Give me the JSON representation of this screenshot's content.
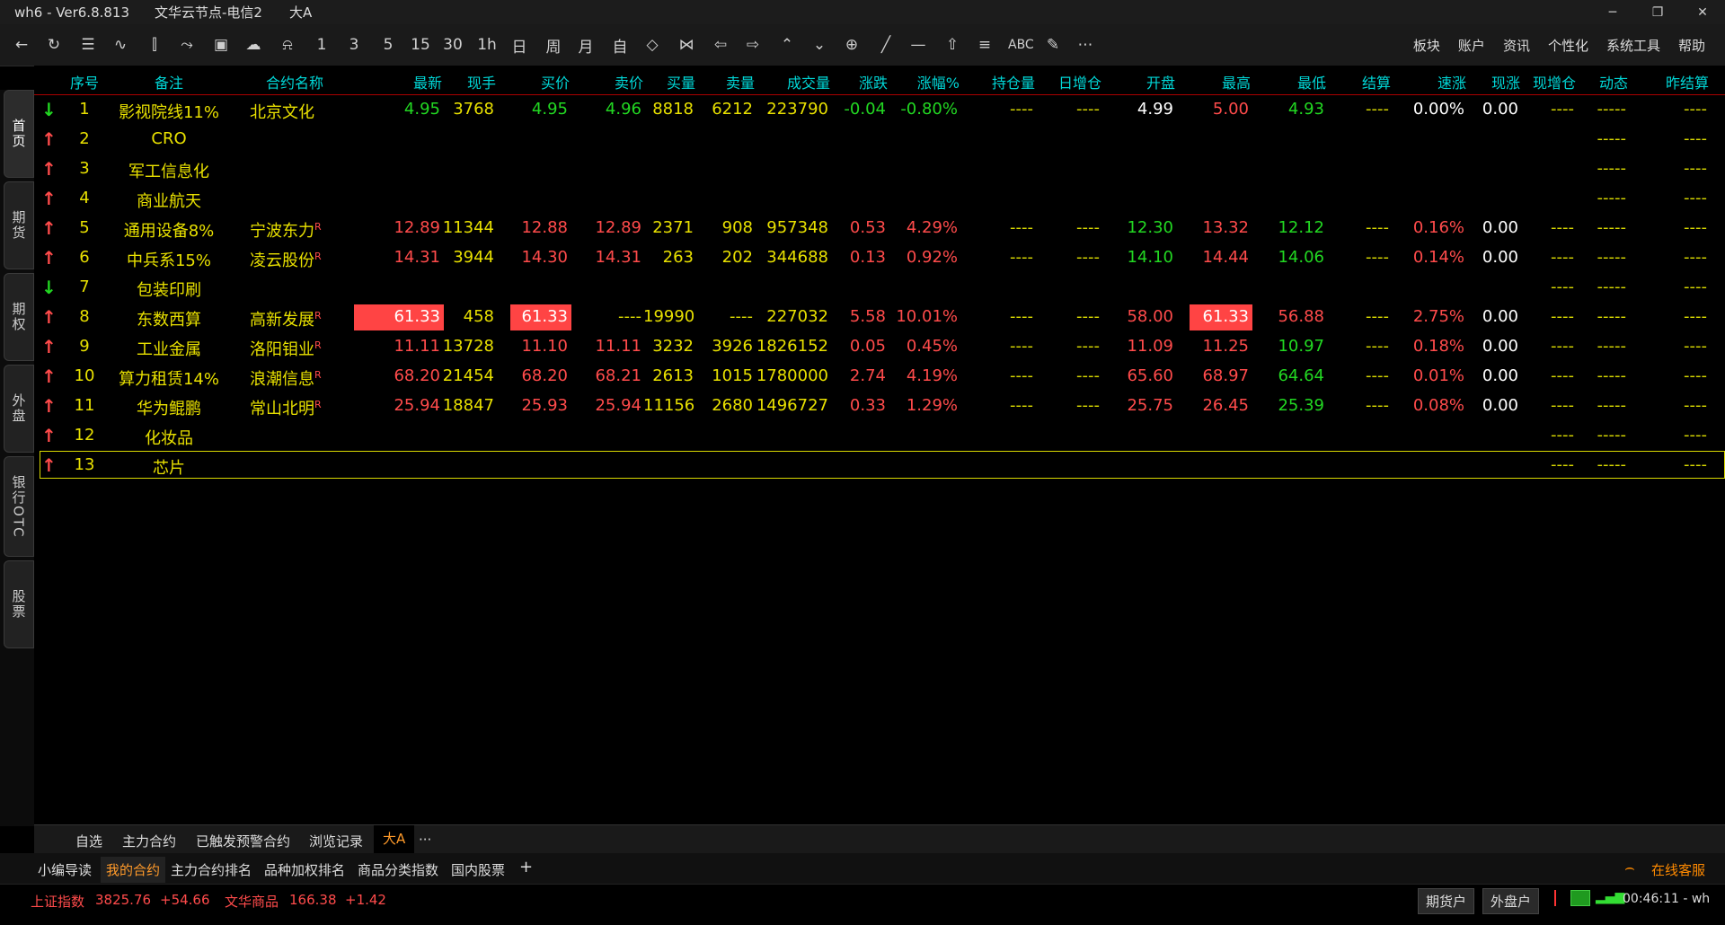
{
  "titlebar": {
    "app": "wh6  -  Ver6.8.813",
    "node": "文华云节点-电信2",
    "page": "大A"
  },
  "toolbar": {
    "periods": [
      "1",
      "3",
      "5",
      "15",
      "30",
      "1h",
      "日",
      "周",
      "月",
      "自"
    ],
    "abc_label": "ABC",
    "right_menu": [
      "板块",
      "账户",
      "资讯",
      "个性化",
      "系统工具",
      "帮助"
    ]
  },
  "sidetabs": [
    "首页",
    "期货",
    "期权",
    "外盘",
    "银行OTC",
    "股票"
  ],
  "table": {
    "headers": [
      "序号",
      "备注",
      "合约名称",
      "最新",
      "现手",
      "买价",
      "卖价",
      "买量",
      "卖量",
      "成交量",
      "涨跌",
      "涨幅%",
      "持仓量",
      "日增仓",
      "开盘",
      "最高",
      "最低",
      "结算",
      "速涨",
      "现涨",
      "现增仓",
      "动态",
      "昨结算"
    ],
    "colors": {
      "up": "#ff4b4b",
      "down": "#22d822",
      "neutral": "#ffffff",
      "note": "#e8e000",
      "dash": "#d8d800",
      "highlight_bg": "#ff4444"
    },
    "rows": [
      {
        "dir": "down",
        "no": "1",
        "note": "影视院线11%",
        "name": "北京文化",
        "r": "",
        "last": "4.95",
        "vol_now": "3768",
        "bid": "4.95",
        "ask": "4.96",
        "bid_q": "8818",
        "ask_q": "6212",
        "volume": "223790",
        "chg": "-0.04",
        "pct": "-0.80%",
        "oi": "----",
        "oi_day": "----",
        "open": "4.99",
        "high": "5.00",
        "low": "4.93",
        "settle": "----",
        "speed": "0.00%",
        "cur_up": "0.00",
        "cur_oi": "----",
        "dyn": "-----",
        "pre": "----",
        "c_last": "down",
        "c_open": "neutral",
        "c_high": "up",
        "c_low": "down",
        "c_speed": "neutral"
      },
      {
        "dir": "up",
        "no": "2",
        "note": "CRO",
        "name": "",
        "r": "",
        "last": "",
        "vol_now": "",
        "bid": "",
        "ask": "",
        "bid_q": "",
        "ask_q": "",
        "volume": "",
        "chg": "",
        "pct": "",
        "oi": "",
        "oi_day": "",
        "open": "",
        "high": "",
        "low": "",
        "settle": "",
        "speed": "",
        "cur_up": "",
        "cur_oi": "",
        "dyn": "-----",
        "pre": "----"
      },
      {
        "dir": "up",
        "no": "3",
        "note": "军工信息化",
        "name": "",
        "r": "",
        "last": "",
        "vol_now": "",
        "bid": "",
        "ask": "",
        "bid_q": "",
        "ask_q": "",
        "volume": "",
        "chg": "",
        "pct": "",
        "oi": "",
        "oi_day": "",
        "open": "",
        "high": "",
        "low": "",
        "settle": "",
        "speed": "",
        "cur_up": "",
        "cur_oi": "",
        "dyn": "-----",
        "pre": "----"
      },
      {
        "dir": "up",
        "no": "4",
        "note": "商业航天",
        "name": "",
        "r": "",
        "last": "",
        "vol_now": "",
        "bid": "",
        "ask": "",
        "bid_q": "",
        "ask_q": "",
        "volume": "",
        "chg": "",
        "pct": "",
        "oi": "",
        "oi_day": "",
        "open": "",
        "high": "",
        "low": "",
        "settle": "",
        "speed": "",
        "cur_up": "",
        "cur_oi": "",
        "dyn": "-----",
        "pre": "----"
      },
      {
        "dir": "up",
        "no": "5",
        "note": "通用设备8%",
        "name": "宁波东力",
        "r": "R",
        "last": "12.89",
        "vol_now": "11344",
        "bid": "12.88",
        "ask": "12.89",
        "bid_q": "2371",
        "ask_q": "908",
        "volume": "957348",
        "chg": "0.53",
        "pct": "4.29%",
        "oi": "----",
        "oi_day": "----",
        "open": "12.30",
        "high": "13.32",
        "low": "12.12",
        "settle": "----",
        "speed": "0.16%",
        "cur_up": "0.00",
        "cur_oi": "----",
        "dyn": "-----",
        "pre": "----",
        "c_last": "up",
        "c_open": "down",
        "c_high": "up",
        "c_low": "down",
        "c_speed": "up"
      },
      {
        "dir": "up",
        "no": "6",
        "note": "中兵系15%",
        "name": "凌云股份",
        "r": "R",
        "last": "14.31",
        "vol_now": "3944",
        "bid": "14.30",
        "ask": "14.31",
        "bid_q": "263",
        "ask_q": "202",
        "volume": "344688",
        "chg": "0.13",
        "pct": "0.92%",
        "oi": "----",
        "oi_day": "----",
        "open": "14.10",
        "high": "14.44",
        "low": "14.06",
        "settle": "----",
        "speed": "0.14%",
        "cur_up": "0.00",
        "cur_oi": "----",
        "dyn": "-----",
        "pre": "----",
        "c_last": "up",
        "c_open": "down",
        "c_high": "up",
        "c_low": "down",
        "c_speed": "up"
      },
      {
        "dir": "down",
        "no": "7",
        "note": "包装印刷",
        "name": "",
        "r": "",
        "last": "",
        "vol_now": "",
        "bid": "",
        "ask": "",
        "bid_q": "",
        "ask_q": "",
        "volume": "",
        "chg": "",
        "pct": "",
        "oi": "",
        "oi_day": "",
        "open": "",
        "high": "",
        "low": "",
        "settle": "",
        "speed": "",
        "cur_up": "",
        "cur_oi": "----",
        "dyn": "-----",
        "pre": "----"
      },
      {
        "dir": "up",
        "no": "8",
        "note": "东数西算",
        "name": "高新发展",
        "r": "R",
        "last": "61.33",
        "vol_now": "458",
        "bid": "61.33",
        "ask": "----",
        "bid_q": "19990",
        "ask_q": "----",
        "volume": "227032",
        "chg": "5.58",
        "pct": "10.01%",
        "oi": "----",
        "oi_day": "----",
        "open": "58.00",
        "high": "61.33",
        "low": "56.88",
        "settle": "----",
        "speed": "2.75%",
        "cur_up": "0.00",
        "cur_oi": "----",
        "dyn": "-----",
        "pre": "----",
        "c_last": "neutral",
        "c_open": "up",
        "c_high": "neutral",
        "c_low": "up",
        "c_speed": "up",
        "hl": true
      },
      {
        "dir": "up",
        "no": "9",
        "note": "工业金属",
        "name": "洛阳钼业",
        "r": "R",
        "last": "11.11",
        "vol_now": "13728",
        "bid": "11.10",
        "ask": "11.11",
        "bid_q": "3232",
        "ask_q": "3926",
        "volume": "1826152",
        "chg": "0.05",
        "pct": "0.45%",
        "oi": "----",
        "oi_day": "----",
        "open": "11.09",
        "high": "11.25",
        "low": "10.97",
        "settle": "----",
        "speed": "0.18%",
        "cur_up": "0.00",
        "cur_oi": "----",
        "dyn": "-----",
        "pre": "----",
        "c_last": "up",
        "c_open": "up",
        "c_high": "up",
        "c_low": "down",
        "c_speed": "up"
      },
      {
        "dir": "up",
        "no": "10",
        "note": "算力租赁14%",
        "name": "浪潮信息",
        "r": "R",
        "last": "68.20",
        "vol_now": "21454",
        "bid": "68.20",
        "ask": "68.21",
        "bid_q": "2613",
        "ask_q": "1015",
        "volume": "1780000",
        "chg": "2.74",
        "pct": "4.19%",
        "oi": "----",
        "oi_day": "----",
        "open": "65.60",
        "high": "68.97",
        "low": "64.64",
        "settle": "----",
        "speed": "0.01%",
        "cur_up": "0.00",
        "cur_oi": "----",
        "dyn": "-----",
        "pre": "----",
        "c_last": "up",
        "c_open": "up",
        "c_high": "up",
        "c_low": "down",
        "c_speed": "up"
      },
      {
        "dir": "up",
        "no": "11",
        "note": "华为鲲鹏",
        "name": "常山北明",
        "r": "R",
        "last": "25.94",
        "vol_now": "18847",
        "bid": "25.93",
        "ask": "25.94",
        "bid_q": "11156",
        "ask_q": "2680",
        "volume": "1496727",
        "chg": "0.33",
        "pct": "1.29%",
        "oi": "----",
        "oi_day": "----",
        "open": "25.75",
        "high": "26.45",
        "low": "25.39",
        "settle": "----",
        "speed": "0.08%",
        "cur_up": "0.00",
        "cur_oi": "----",
        "dyn": "-----",
        "pre": "----",
        "c_last": "up",
        "c_open": "up",
        "c_high": "up",
        "c_low": "down",
        "c_speed": "up"
      },
      {
        "dir": "up",
        "no": "12",
        "note": "化妆品",
        "name": "",
        "r": "",
        "last": "",
        "vol_now": "",
        "bid": "",
        "ask": "",
        "bid_q": "",
        "ask_q": "",
        "volume": "",
        "chg": "",
        "pct": "",
        "oi": "",
        "oi_day": "",
        "open": "",
        "high": "",
        "low": "",
        "settle": "",
        "speed": "",
        "cur_up": "",
        "cur_oi": "----",
        "dyn": "-----",
        "pre": "----"
      },
      {
        "dir": "up",
        "no": "13",
        "note": "芯片",
        "name": "",
        "r": "",
        "last": "",
        "vol_now": "",
        "bid": "",
        "ask": "",
        "bid_q": "",
        "ask_q": "",
        "volume": "",
        "chg": "",
        "pct": "",
        "oi": "",
        "oi_day": "",
        "open": "",
        "high": "",
        "low": "",
        "settle": "",
        "speed": "",
        "cur_up": "",
        "cur_oi": "----",
        "dyn": "-----",
        "pre": "----",
        "selected": true
      }
    ]
  },
  "bottom_tabs": [
    "自选",
    "主力合约",
    "已触发预警合约",
    "浏览记录",
    "大A",
    "···"
  ],
  "bottom_tabs_active": "大A",
  "nav_tabs": [
    "小编导读",
    "我的合约",
    "主力合约排名",
    "品种加权排名",
    "商品分类指数",
    "国内股票",
    "+"
  ],
  "nav_tabs_active": "我的合约",
  "online_service": "在线客服",
  "status": {
    "idx1_name": "上证指数",
    "idx1_value": "3825.76",
    "idx1_change": "+54.66",
    "idx2_name": "文华商品",
    "idx2_value": "166.38",
    "idx2_change": "+1.42",
    "btn_futures": "期货户",
    "btn_foreign": "外盘户",
    "clock": "00:46:11 - wh"
  }
}
